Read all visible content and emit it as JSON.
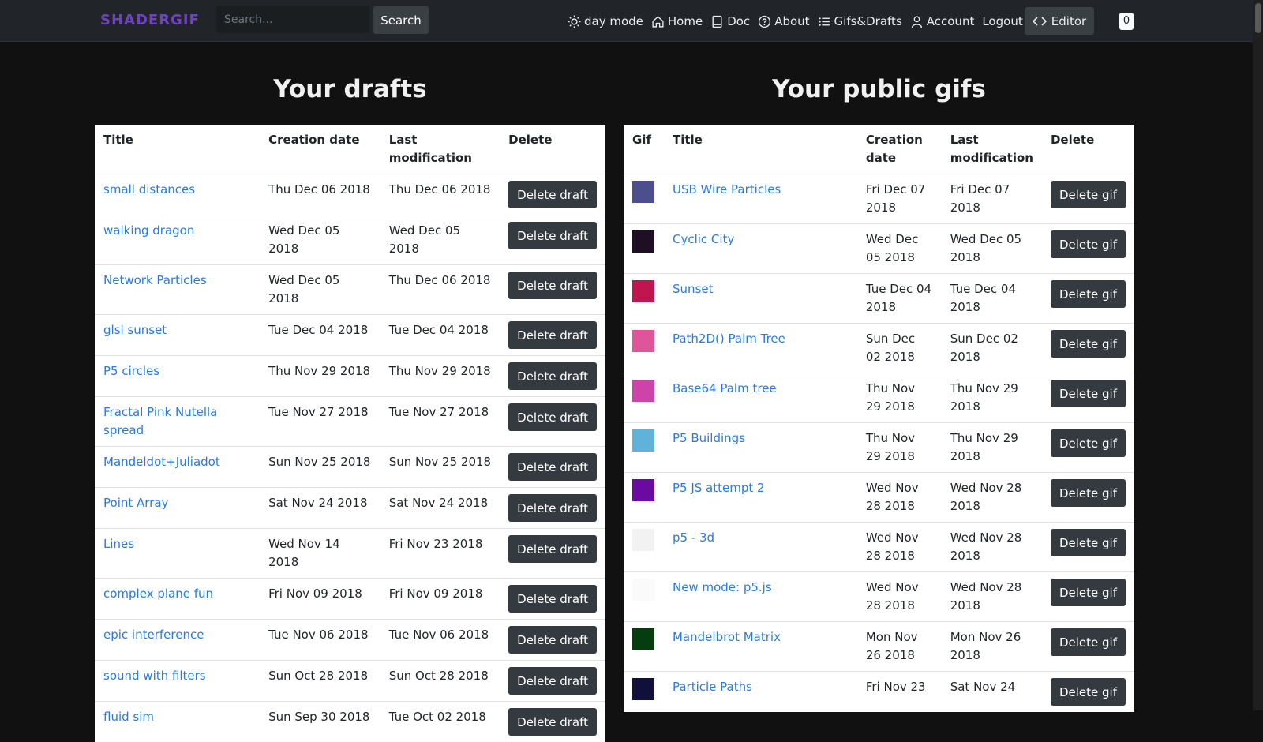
{
  "nav": {
    "brand": "SHADERGIF",
    "search_placeholder": "Search...",
    "search_button": "Search",
    "links": [
      {
        "label": "day mode",
        "icon": "sun-icon"
      },
      {
        "label": "Home",
        "icon": "home-icon"
      },
      {
        "label": "Doc",
        "icon": "book-icon"
      },
      {
        "label": "About",
        "icon": "question-circle-icon"
      },
      {
        "label": "Gifs&Drafts",
        "icon": "list-icon"
      },
      {
        "label": "Account",
        "icon": "user-icon"
      },
      {
        "label": "Logout",
        "icon": ""
      }
    ],
    "editor_button": "Editor",
    "badge_count": "0"
  },
  "drafts": {
    "heading": "Your drafts",
    "columns": [
      "Title",
      "Creation date",
      "Last modification",
      "Delete"
    ],
    "delete_label": "Delete draft",
    "rows": [
      {
        "title": "small distances",
        "created": "Thu Dec 06 2018",
        "modified": "Thu Dec 06 2018"
      },
      {
        "title": "walking dragon",
        "created": "Wed Dec 05 2018",
        "modified": "Wed Dec 05 2018"
      },
      {
        "title": "Network Particles",
        "created": "Wed Dec 05 2018",
        "modified": "Thu Dec 06 2018"
      },
      {
        "title": "glsl sunset",
        "created": "Tue Dec 04 2018",
        "modified": "Tue Dec 04 2018"
      },
      {
        "title": "P5 circles",
        "created": "Thu Nov 29 2018",
        "modified": "Thu Nov 29 2018"
      },
      {
        "title": "Fractal Pink Nutella spread",
        "created": "Tue Nov 27 2018",
        "modified": "Tue Nov 27 2018"
      },
      {
        "title": "Mandeldot+Juliadot",
        "created": "Sun Nov 25 2018",
        "modified": "Sun Nov 25 2018"
      },
      {
        "title": "Point Array",
        "created": "Sat Nov 24 2018",
        "modified": "Sat Nov 24 2018"
      },
      {
        "title": "Lines",
        "created": "Wed Nov 14 2018",
        "modified": "Fri Nov 23 2018"
      },
      {
        "title": "complex plane fun",
        "created": "Fri Nov 09 2018",
        "modified": "Fri Nov 09 2018"
      },
      {
        "title": "epic interference",
        "created": "Tue Nov 06 2018",
        "modified": "Tue Nov 06 2018"
      },
      {
        "title": "sound with filters",
        "created": "Sun Oct 28 2018",
        "modified": "Sun Oct 28 2018"
      },
      {
        "title": "fluid sim",
        "created": "Sun Sep 30 2018",
        "modified": "Tue Oct 02 2018"
      }
    ]
  },
  "gifs": {
    "heading": "Your public gifs",
    "columns": [
      "Gif",
      "Title",
      "Creation date",
      "Last modification",
      "Delete"
    ],
    "delete_label": "Delete gif",
    "rows": [
      {
        "title": "USB Wire Particles",
        "created": "Fri Dec 07 2018",
        "modified": "Fri Dec 07 2018",
        "thumb_color": "#4d4f8c"
      },
      {
        "title": "Cyclic City",
        "created": "Wed Dec 05 2018",
        "modified": "Wed Dec 05 2018",
        "thumb_color": "#1e0f24"
      },
      {
        "title": "Sunset",
        "created": "Tue Dec 04 2018",
        "modified": "Tue Dec 04 2018",
        "thumb_color": "#c0154e"
      },
      {
        "title": "Path2D() Palm Tree",
        "created": "Sun Dec 02 2018",
        "modified": "Sun Dec 02 2018",
        "thumb_color": "#e0559a"
      },
      {
        "title": "Base64 Palm tree",
        "created": "Thu Nov 29 2018",
        "modified": "Thu Nov 29 2018",
        "thumb_color": "#cc44a8"
      },
      {
        "title": "P5 Buildings",
        "created": "Thu Nov 29 2018",
        "modified": "Thu Nov 29 2018",
        "thumb_color": "#5fb2d8"
      },
      {
        "title": "P5 JS attempt 2",
        "created": "Wed Nov 28 2018",
        "modified": "Wed Nov 28 2018",
        "thumb_color": "#6a0aa0"
      },
      {
        "title": "p5 - 3d",
        "created": "Wed Nov 28 2018",
        "modified": "Wed Nov 28 2018",
        "thumb_color": "#f2f2f2"
      },
      {
        "title": "New mode: p5.js",
        "created": "Wed Nov 28 2018",
        "modified": "Wed Nov 28 2018",
        "thumb_color": "#fafafa"
      },
      {
        "title": "Mandelbrot Matrix",
        "created": "Mon Nov 26 2018",
        "modified": "Mon Nov 26 2018",
        "thumb_color": "#063d0e"
      },
      {
        "title": "Particle Paths",
        "created": "Fri Nov 23",
        "modified": "Sat Nov 24",
        "thumb_color": "#10103a"
      }
    ]
  }
}
